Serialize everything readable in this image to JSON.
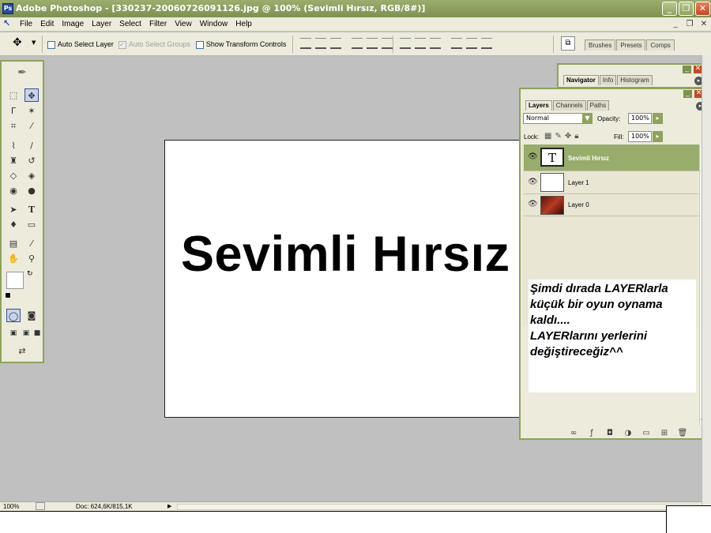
{
  "window": {
    "title": "Adobe Photoshop - [330237-20060726091126.jpg @ 100% (Sevimli Hırsız, RGB/8#)]",
    "app_icon": "photoshop-icon",
    "min_glyph": "_",
    "max_glyph": "❐",
    "close_glyph": "✕"
  },
  "menu": {
    "items": [
      "File",
      "Edit",
      "Image",
      "Layer",
      "Select",
      "Filter",
      "View",
      "Window",
      "Help"
    ],
    "doc_min": "_",
    "doc_restore": "❐",
    "doc_close": "✕"
  },
  "options": {
    "auto_select_layer": "Auto Select Layer",
    "auto_select_groups": "Auto Select Groups",
    "show_transform_controls": "Show Transform Controls",
    "well_tabs": [
      "Brushes",
      "Presets",
      "Comps"
    ]
  },
  "canvas": {
    "text": "Sevimli Hırsız"
  },
  "navigator": {
    "tabs": [
      "Navigator",
      "Info",
      "Histogram"
    ]
  },
  "layers_panel": {
    "tabs": [
      "Layers",
      "Channels",
      "Paths"
    ],
    "blend_mode": "Normal",
    "opacity_label": "Opacity:",
    "opacity_value": "100%",
    "lock_label": "Lock:",
    "fill_label": "Fill:",
    "fill_value": "100%",
    "layers": [
      {
        "name": "Sevimli Hırsız",
        "thumb": "T",
        "selected": true
      },
      {
        "name": "Layer 1",
        "thumb": "",
        "selected": false
      },
      {
        "name": "Layer 0",
        "thumb": "",
        "selected": false
      }
    ]
  },
  "note": {
    "lines": [
      "Şimdi dırada LAYERlarla",
      "küçük bir oyun oynama",
      "kaldı....",
      "LAYERlarını yerlerini",
      "değiştireceğiz^^"
    ]
  },
  "status": {
    "zoom": "100%",
    "doc": "Doc: 624,6K/815,1K"
  },
  "colors": {
    "title_green": "#8fa25c",
    "selected_layer": "#98ac6c",
    "close_red": "#c14a25"
  }
}
